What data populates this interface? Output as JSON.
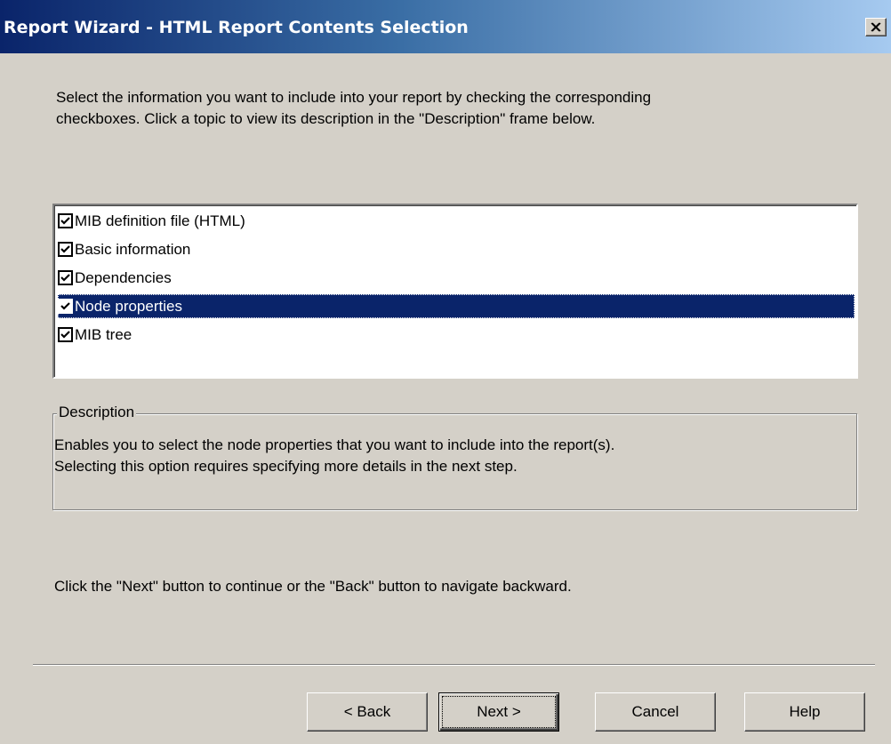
{
  "window": {
    "title": "Report Wizard - HTML Report Contents Selection",
    "close_icon": "close-icon"
  },
  "intro": {
    "line1": "Select the information you want to include into your report by checking the corresponding",
    "line2": "checkboxes. Click a topic to view its description in the \"Description\" frame below."
  },
  "topics": [
    {
      "label": "MIB definition file (HTML)",
      "checked": true,
      "selected": false
    },
    {
      "label": "Basic information",
      "checked": true,
      "selected": false
    },
    {
      "label": "Dependencies",
      "checked": true,
      "selected": false
    },
    {
      "label": "Node properties",
      "checked": true,
      "selected": true
    },
    {
      "label": "MIB tree",
      "checked": true,
      "selected": false
    }
  ],
  "description": {
    "legend": "Description",
    "line1": "Enables you to select the node properties that you want to include into the report(s).",
    "line2": "Selecting this option requires specifying more details in the next step."
  },
  "footer": {
    "hint": "Click the \"Next\" button to continue or the \"Back\" button to navigate backward."
  },
  "buttons": {
    "back": "< Back",
    "next": "Next >",
    "cancel": "Cancel",
    "help": "Help"
  },
  "colors": {
    "face": "#d4d0c8",
    "title_start": "#0a246a",
    "title_end": "#a6caf0",
    "selection": "#0a246a"
  }
}
